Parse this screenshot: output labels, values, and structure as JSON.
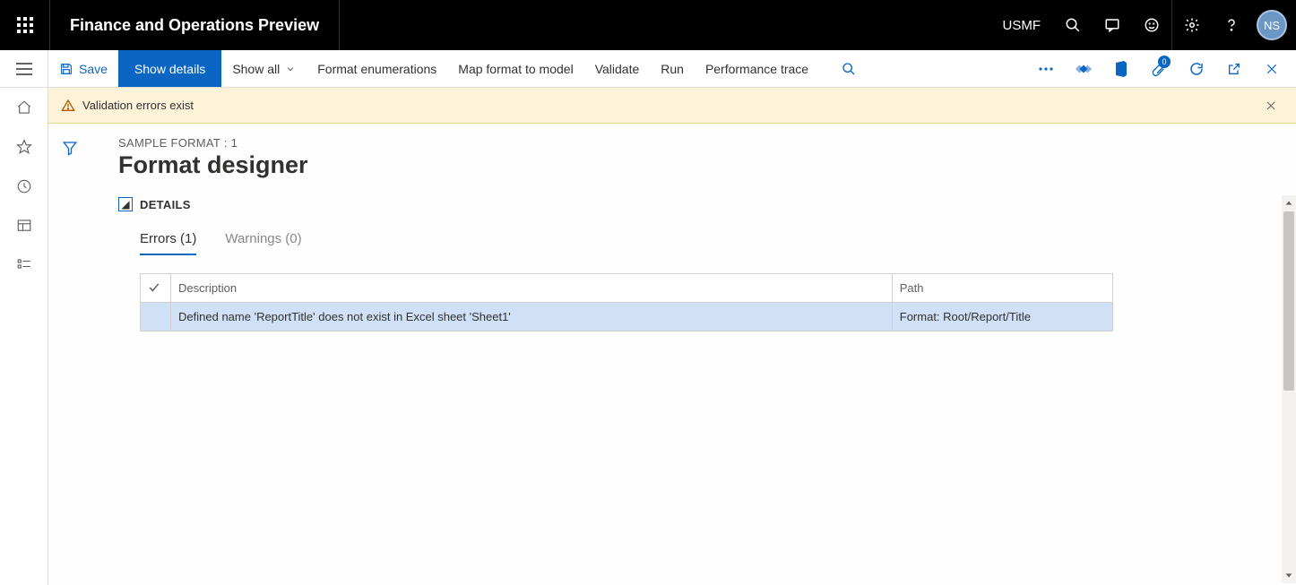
{
  "header": {
    "app_title": "Finance and Operations Preview",
    "company": "USMF",
    "avatar_initials": "NS"
  },
  "cmdbar": {
    "save": "Save",
    "show_details": "Show details",
    "show_all": "Show all",
    "format_enumerations": "Format enumerations",
    "map_format": "Map format to model",
    "validate": "Validate",
    "run": "Run",
    "performance_trace": "Performance trace",
    "badge_count": "0"
  },
  "banner": {
    "message": "Validation errors exist"
  },
  "page": {
    "breadcrumb": "SAMPLE FORMAT : 1",
    "title": "Format designer",
    "details_label": "DETAILS"
  },
  "tabs": {
    "errors": "Errors (1)",
    "warnings": "Warnings (0)"
  },
  "table": {
    "col_description": "Description",
    "col_path": "Path",
    "rows": [
      {
        "description": "Defined name 'ReportTitle' does not exist in Excel sheet 'Sheet1'",
        "path": "Format: Root/Report/Title"
      }
    ]
  }
}
